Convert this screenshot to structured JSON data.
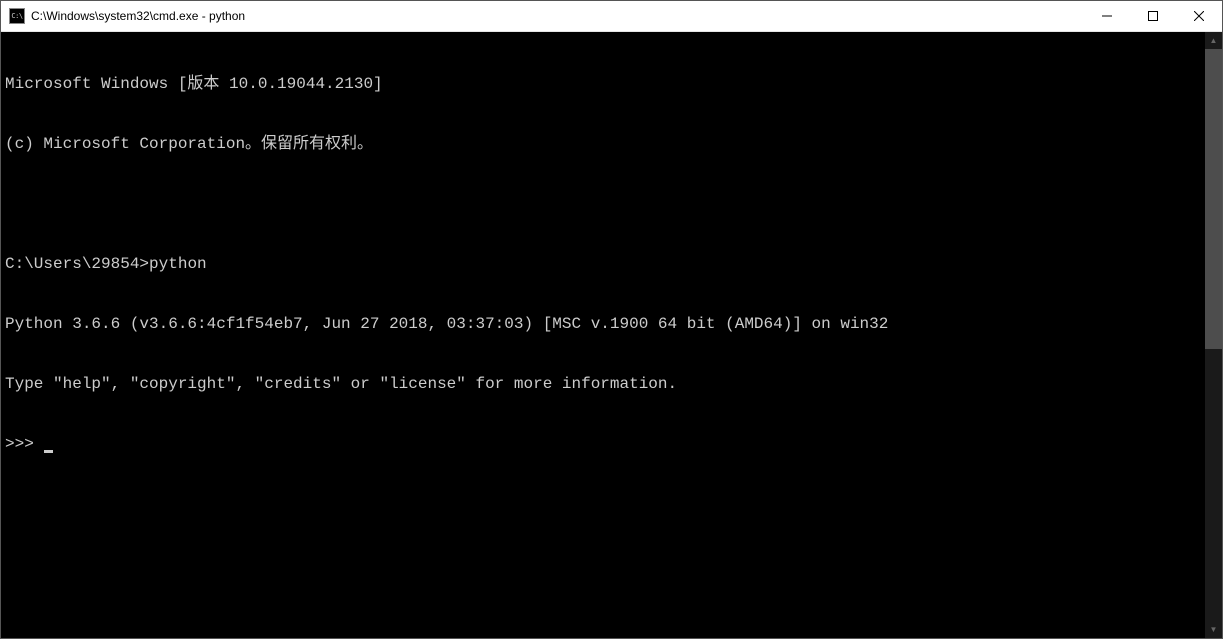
{
  "window": {
    "icon_text": "C:\\",
    "title": "C:\\Windows\\system32\\cmd.exe - python"
  },
  "terminal": {
    "line1": "Microsoft Windows [版本 10.0.19044.2130]",
    "line2": "(c) Microsoft Corporation。保留所有权利。",
    "line3": "",
    "line4_prompt": "C:\\Users\\29854>",
    "line4_cmd": "python",
    "line5": "Python 3.6.6 (v3.6.6:4cf1f54eb7, Jun 27 2018, 03:37:03) [MSC v.1900 64 bit (AMD64)] on win32",
    "line6": "Type \"help\", \"copyright\", \"credits\" or \"license\" for more information.",
    "line7_prompt": ">>> "
  }
}
